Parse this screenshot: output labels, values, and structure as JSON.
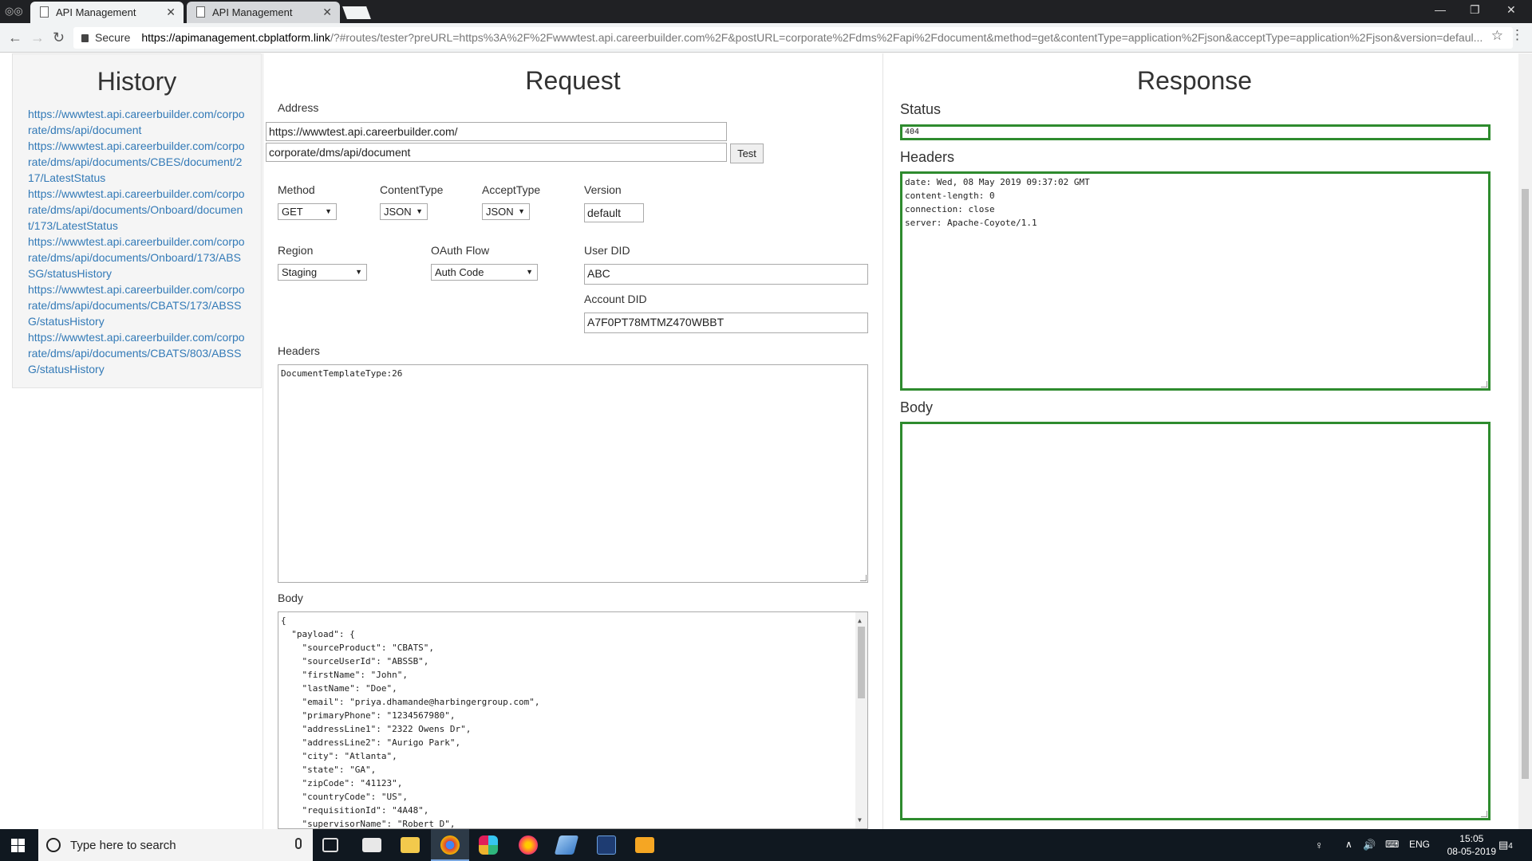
{
  "browser": {
    "tabs": [
      {
        "title": "API Management"
      },
      {
        "title": "API Management"
      }
    ],
    "address": {
      "secure_label": "Secure",
      "url_host": "https://apimanagement.cbplatform.link",
      "url_rest": "/?#routes/tester?preURL=https%3A%2F%2Fwwwtest.api.careerbuilder.com%2F&postURL=corporate%2Fdms%2Fapi%2Fdocument&method=get&contentType=application%2Fjson&acceptType=application%2Fjson&version=defaul..."
    }
  },
  "history": {
    "title": "History",
    "items": [
      "https://wwwtest.api.careerbuilder.com/corporate/dms/api/document",
      "https://wwwtest.api.careerbuilder.com/corporate/dms/api/documents/CBES/document/217/LatestStatus",
      "https://wwwtest.api.careerbuilder.com/corporate/dms/api/documents/Onboard/document/173/LatestStatus",
      "https://wwwtest.api.careerbuilder.com/corporate/dms/api/documents/Onboard/173/ABSSG/statusHistory",
      "https://wwwtest.api.careerbuilder.com/corporate/dms/api/documents/CBATS/173/ABSSG/statusHistory",
      "https://wwwtest.api.careerbuilder.com/corporate/dms/api/documents/CBATS/803/ABSSG/statusHistory"
    ]
  },
  "request": {
    "title": "Request",
    "address_label": "Address",
    "address_pre": "https://wwwtest.api.careerbuilder.com/",
    "address_post": "corporate/dms/api/document",
    "test_button": "Test",
    "method_label": "Method",
    "method_value": "GET",
    "content_type_label": "ContentType",
    "content_type_value": "JSON",
    "accept_type_label": "AcceptType",
    "accept_type_value": "JSON",
    "version_label": "Version",
    "version_value": "default",
    "region_label": "Region",
    "region_value": "Staging",
    "oauth_label": "OAuth Flow",
    "oauth_value": "Auth Code",
    "user_did_label": "User DID",
    "user_did_value": "ABC",
    "account_did_label": "Account DID",
    "account_did_value": "A7F0PT78MTMZ470WBBT",
    "headers_label": "Headers",
    "headers_value": "DocumentTemplateType:26",
    "body_label": "Body",
    "body_value": "{\n  \"payload\": {\n    \"sourceProduct\": \"CBATS\",\n    \"sourceUserId\": \"ABSSB\",\n    \"firstName\": \"John\",\n    \"lastName\": \"Doe\",\n    \"email\": \"priya.dhamande@harbingergroup.com\",\n    \"primaryPhone\": \"1234567980\",\n    \"addressLine1\": \"2322 Owens Dr\",\n    \"addressLine2\": \"Aurigo Park\",\n    \"city\": \"Atlanta\",\n    \"state\": \"GA\",\n    \"zipCode\": \"41123\",\n    \"countryCode\": \"US\",\n    \"requisitionId\": \"4A48\",\n    \"supervisorName\": \"Robert D\","
  },
  "response": {
    "title": "Response",
    "status_label": "Status",
    "status_value": "404",
    "headers_label": "Headers",
    "headers_value": "date: Wed, 08 May 2019 09:37:02 GMT\ncontent-length: 0\nconnection: close\nserver: Apache-Coyote/1.1",
    "body_label": "Body",
    "body_value": ""
  },
  "taskbar": {
    "search_placeholder": "Type here to search",
    "language": "ENG",
    "time": "15:05",
    "date": "08-05-2019",
    "notifications": "4"
  },
  "colors": {
    "link": "#337ab7",
    "response_border": "#2e8b2e",
    "taskbar": "#101820"
  }
}
